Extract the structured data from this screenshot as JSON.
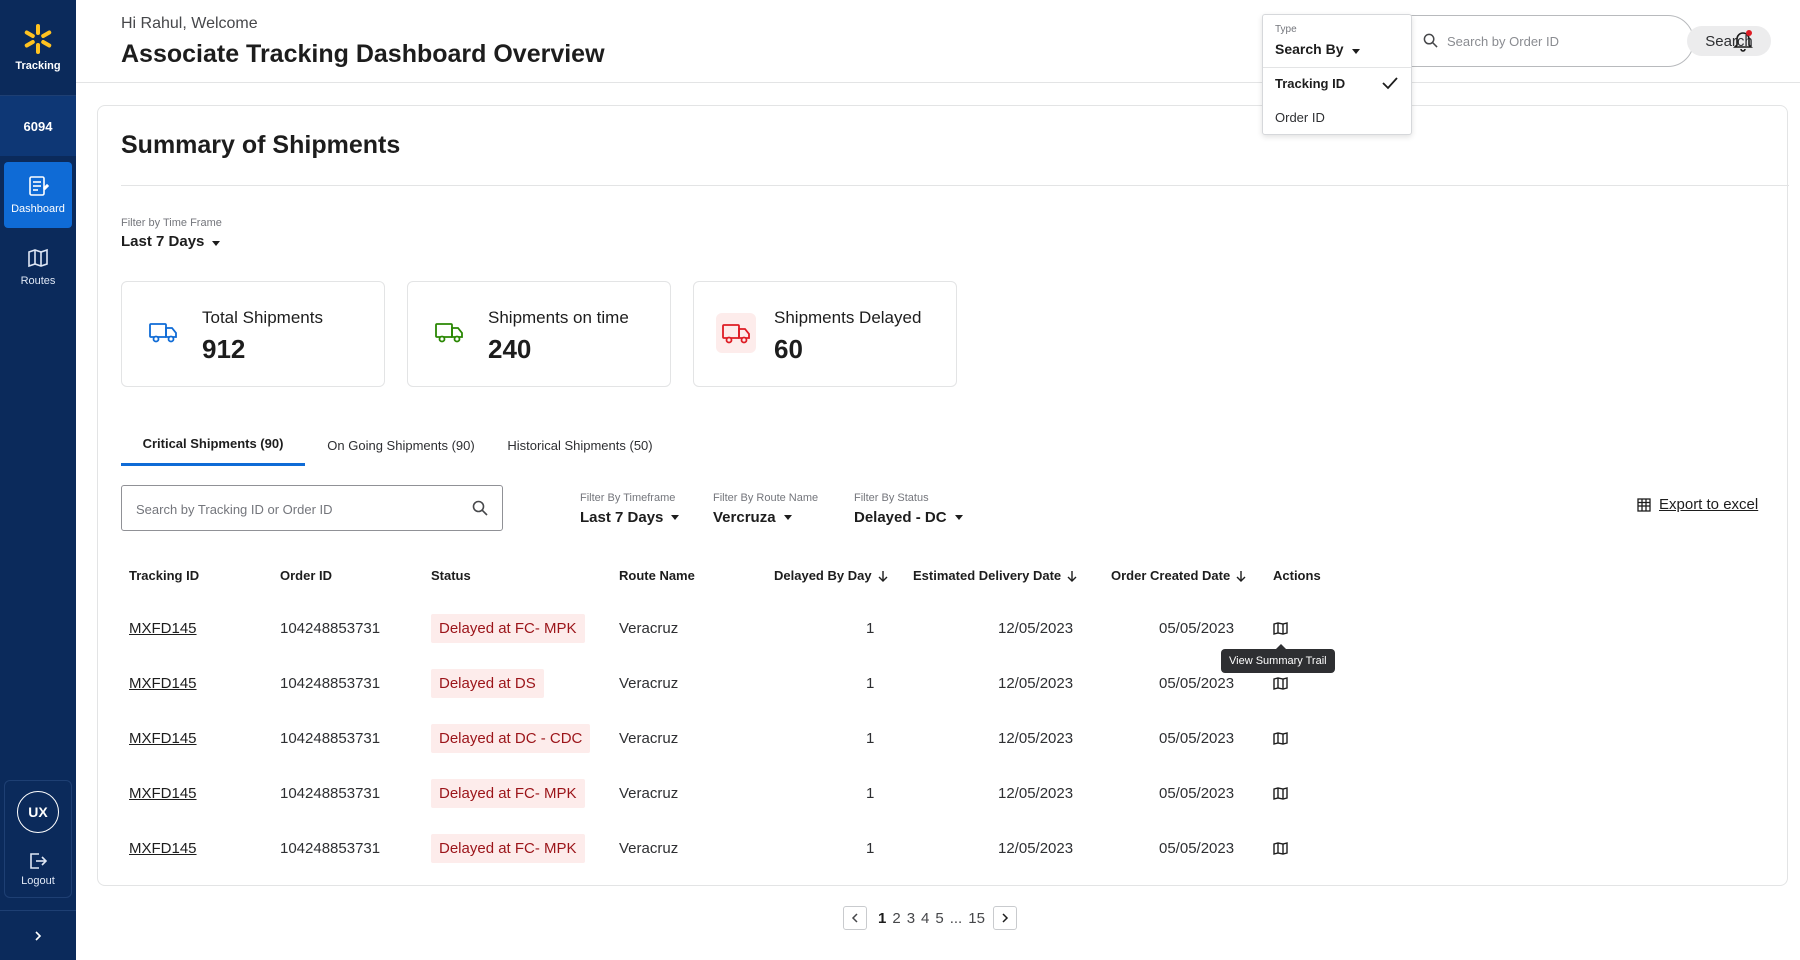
{
  "sidebar": {
    "brand_label": "Tracking",
    "store_number": "6094",
    "items": [
      {
        "label": "Dashboard",
        "icon": "dashboard-icon",
        "active": true
      },
      {
        "label": "Routes",
        "icon": "map-icon",
        "active": false
      }
    ],
    "user_initials": "UX",
    "logout_label": "Logout"
  },
  "header": {
    "greeting": "Hi Rahul, Welcome",
    "title": "Associate Tracking Dashboard Overview",
    "search_placeholder": "Search by Order ID",
    "search_button": "Search"
  },
  "type_dropdown": {
    "label": "Type",
    "selected": "Search By",
    "options": [
      "Tracking ID",
      "Order ID"
    ],
    "checked_option": "Tracking ID"
  },
  "summary": {
    "title": "Summary of Shipments",
    "filter_label": "Filter by  Time Frame",
    "filter_value": "Last 7 Days",
    "stats": [
      {
        "label": "Total Shipments",
        "value": "912",
        "icon": "truck-icon"
      },
      {
        "label": "Shipments on time",
        "value": "240",
        "icon": "truck-icon"
      },
      {
        "label": "Shipments Delayed",
        "value": "60",
        "icon": "truck-icon"
      }
    ]
  },
  "tabs": [
    {
      "label": "Critical Shipments (90)",
      "active": true
    },
    {
      "label": "On Going Shipments  (90)",
      "active": false
    },
    {
      "label": "Historical Shipments (50)",
      "active": false
    }
  ],
  "table_controls": {
    "search_placeholder": "Search by Tracking ID or Order ID",
    "filters": [
      {
        "label": "Filter By Timeframe",
        "value": "Last 7 Days"
      },
      {
        "label": "Filter By Route Name",
        "value": "Vercruza"
      },
      {
        "label": "Filter By Status",
        "value": "Delayed - DC"
      }
    ],
    "export_label": "Export to excel"
  },
  "table": {
    "columns": [
      "Tracking ID",
      "Order ID",
      "Status",
      "Route Name",
      "Delayed By Day",
      "Estimated Delivery Date",
      "Order Created Date",
      "Actions"
    ],
    "rows": [
      {
        "tracking_id": "MXFD145",
        "order_id": "104248853731",
        "status": "Delayed at FC- MPK",
        "route": "Veracruz",
        "delayed_by": "1",
        "est_delivery": "12/05/2023",
        "created": "05/05/2023"
      },
      {
        "tracking_id": "MXFD145",
        "order_id": "104248853731",
        "status": "Delayed at DS",
        "route": "Veracruz",
        "delayed_by": "1",
        "est_delivery": "12/05/2023",
        "created": "05/05/2023"
      },
      {
        "tracking_id": "MXFD145",
        "order_id": "104248853731",
        "status": "Delayed at DC - CDC",
        "route": "Veracruz",
        "delayed_by": "1",
        "est_delivery": "12/05/2023",
        "created": "05/05/2023"
      },
      {
        "tracking_id": "MXFD145",
        "order_id": "104248853731",
        "status": "Delayed at FC- MPK",
        "route": "Veracruz",
        "delayed_by": "1",
        "est_delivery": "12/05/2023",
        "created": "05/05/2023"
      },
      {
        "tracking_id": "MXFD145",
        "order_id": "104248853731",
        "status": "Delayed at FC- MPK",
        "route": "Veracruz",
        "delayed_by": "1",
        "est_delivery": "12/05/2023",
        "created": "05/05/2023"
      }
    ],
    "tooltip": "View Summary Trail"
  },
  "pagination": {
    "pages": [
      "1",
      "2",
      "3",
      "4",
      "5",
      "...",
      "15"
    ],
    "current": "1"
  },
  "colors": {
    "sidebar_bg": "#0b2a5b",
    "accent": "#0f6bd6",
    "brand_spark": "#ffc220",
    "status_bg": "#fdeceb",
    "status_text": "#9b1419",
    "truck_blue": "#0f6bd6",
    "truck_green": "#2a8703",
    "truck_red": "#de1c24"
  }
}
